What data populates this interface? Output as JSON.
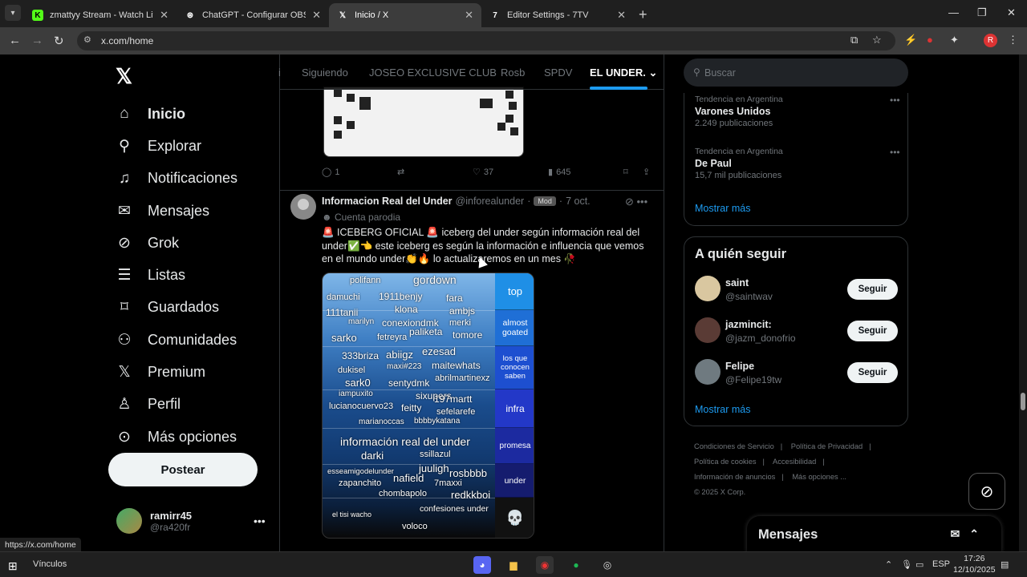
{
  "browser": {
    "tabs": [
      {
        "title": "zmattyy Stream - Watch Live on",
        "icon": "kick-icon",
        "color": "#53fc18"
      },
      {
        "title": "ChatGPT - Configurar OBS para",
        "icon": "chatgpt-icon",
        "color": "#ffffff"
      },
      {
        "title": "Inicio / X",
        "icon": "x-icon",
        "color": "#ffffff"
      },
      {
        "title": "Editor Settings - 7TV",
        "icon": "7tv-icon",
        "color": "#ffffff"
      }
    ],
    "url": "x.com/home",
    "profile_initial": "R",
    "status_url": "https://x.com/home"
  },
  "sidebar": {
    "items": [
      {
        "label": "Inicio",
        "icon": "home-icon"
      },
      {
        "label": "Explorar",
        "icon": "search-icon"
      },
      {
        "label": "Notificaciones",
        "icon": "bell-icon"
      },
      {
        "label": "Mensajes",
        "icon": "mail-icon"
      },
      {
        "label": "Grok",
        "icon": "grok-icon"
      },
      {
        "label": "Listas",
        "icon": "list-icon"
      },
      {
        "label": "Guardados",
        "icon": "bookmark-icon"
      },
      {
        "label": "Comunidades",
        "icon": "communities-icon"
      },
      {
        "label": "Premium",
        "icon": "x-premium-icon"
      },
      {
        "label": "Perfil",
        "icon": "profile-icon"
      },
      {
        "label": "Más opciones",
        "icon": "more-options-icon"
      }
    ],
    "post_label": "Postear",
    "user": {
      "name": "ramirr45",
      "handle": "@ra420fr"
    }
  },
  "feed": {
    "tabs": [
      "i",
      "Siguiendo",
      "JOSEO EXCLUSIVE CLUB",
      "Rosb",
      "SPDV",
      "EL UNDER."
    ],
    "prev_actions": {
      "replies": "1",
      "likes": "37",
      "views": "645"
    },
    "tweet": {
      "name": "Informacion Real del Under",
      "handle": "@inforealunder",
      "badge": "Mod",
      "date": "7 oct.",
      "parody": "Cuenta parodia",
      "text": "🚨 ICEBERG OFICIAL 🚨 iceberg del under según información real del under✅👈 este iceberg es según la información e influencia que vemos en el mundo under👏🔥 lo actualizaremos en un mes 🥀"
    },
    "iceberg": {
      "tiers": [
        "top",
        "almost goated",
        "los que conocen saben",
        "infra",
        "promesa",
        "under",
        "💀"
      ],
      "words": [
        "polifann",
        "gordown",
        "damuchi",
        "1911benjy",
        "fara",
        "111tanii",
        "klona",
        "ambjs",
        "marilyn",
        "conexiondmk",
        "merki",
        "sarko",
        "paliketa",
        "tomore",
        "fetreyra",
        "333briza",
        "abiigz",
        "ezesad",
        "dukisel",
        "maxi#223",
        "maitewhats",
        "sark0",
        "sentydmk",
        "abrilmartinexz",
        "iampuxito",
        "sixupers",
        "197martt",
        "lucianocuervo23",
        "feitty",
        "sefelarefe",
        "marianoccas",
        "bbbbykatana",
        "información real del under",
        "darki",
        "ssillazul",
        "esseamigodelunder",
        "juuligh",
        "rosbbbb",
        "zapanchito",
        "nafield",
        "7maxxi",
        "chombapolo",
        "redkkboi",
        "el tisi wacho",
        "confesiones under",
        "voloco"
      ]
    }
  },
  "right": {
    "search_placeholder": "Buscar",
    "trends": [
      {
        "context": "Tendencia en Argentina",
        "name": "Varones Unidos",
        "count": "2.249 publicaciones"
      },
      {
        "context": "Tendencia en Argentina",
        "name": "De Paul",
        "count": "15,7 mil publicaciones"
      }
    ],
    "show_more": "Mostrar más",
    "wtf_title": "A quién seguir",
    "follow": [
      {
        "name": "saint",
        "handle": "@saintwav",
        "color": "#d9c7a0"
      },
      {
        "name": "jazmincit:",
        "handle": "@jazm_donofrio",
        "color": "#5a3b35"
      },
      {
        "name": "Felipe",
        "handle": "@Felipe19tw",
        "color": "#6f7a80"
      }
    ],
    "follow_label": "Seguir",
    "footer": [
      "Condiciones de Servicio",
      "Política de Privacidad",
      "Política de cookies",
      "Accesibilidad",
      "Información de anuncios",
      "Más opciones ...",
      "© 2025 X Corp."
    ],
    "messages_label": "Mensajes"
  },
  "taskbar": {
    "label": "Vínculos",
    "lang": "ESP",
    "time": "17:26",
    "date": "12/10/2025"
  }
}
